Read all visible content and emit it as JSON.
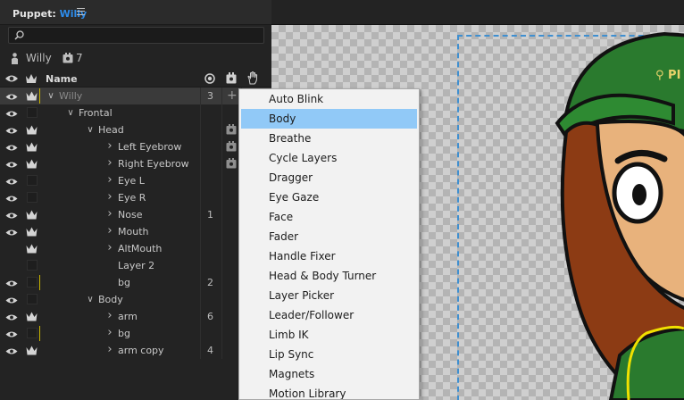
{
  "panel": {
    "title_prefix": "Puppet:",
    "title_name": "Willy",
    "puppet_name": "Willy",
    "handle_count": "7",
    "column_name": "Name"
  },
  "tree": [
    {
      "label": "Willy",
      "indent": 0,
      "arrow": "down",
      "eye": true,
      "crown": true,
      "yellow": true,
      "count": "3",
      "plus": true,
      "selected": true,
      "dim": true
    },
    {
      "label": "Frontal",
      "indent": 1,
      "arrow": "down",
      "eye": true,
      "crown": false,
      "yellow": false,
      "count": "",
      "dim": false
    },
    {
      "label": "Head",
      "indent": 2,
      "arrow": "down",
      "eye": true,
      "crown": true,
      "yellow": false,
      "count": "",
      "handle": true,
      "dim": false
    },
    {
      "label": "Left Eyebrow",
      "indent": 3,
      "arrow": "right",
      "eye": true,
      "crown": true,
      "yellow": false,
      "count": "",
      "handle": true,
      "dim": false
    },
    {
      "label": "Right Eyebrow",
      "indent": 3,
      "arrow": "right",
      "eye": true,
      "crown": true,
      "yellow": false,
      "count": "",
      "handle": true,
      "dim": false
    },
    {
      "label": "Eye L",
      "indent": 3,
      "arrow": "right",
      "eye": true,
      "crown": false,
      "yellow": false,
      "count": "",
      "dim": false
    },
    {
      "label": "Eye R",
      "indent": 3,
      "arrow": "right",
      "eye": true,
      "crown": false,
      "yellow": false,
      "count": "",
      "dim": false
    },
    {
      "label": "Nose",
      "indent": 3,
      "arrow": "right",
      "eye": true,
      "crown": true,
      "yellow": false,
      "count": "1",
      "dim": false
    },
    {
      "label": "Mouth",
      "indent": 3,
      "arrow": "right",
      "eye": true,
      "crown": true,
      "yellow": false,
      "count": "",
      "dim": false
    },
    {
      "label": "AltMouth",
      "indent": 3,
      "arrow": "right",
      "eye": false,
      "crown": true,
      "yellow": false,
      "count": "",
      "dim": false
    },
    {
      "label": "Layer 2",
      "indent": 3,
      "arrow": "none",
      "eye": false,
      "crown": false,
      "yellow": false,
      "count": "",
      "dim": false
    },
    {
      "label": "bg",
      "indent": 3,
      "arrow": "none",
      "eye": true,
      "crown": false,
      "yellow": true,
      "count": "2",
      "dim": false
    },
    {
      "label": "Body",
      "indent": 2,
      "arrow": "down",
      "eye": true,
      "crown": false,
      "yellow": false,
      "count": "",
      "dim": false
    },
    {
      "label": "arm",
      "indent": 3,
      "arrow": "right",
      "eye": true,
      "crown": true,
      "yellow": false,
      "count": "6",
      "dim": false
    },
    {
      "label": "bg",
      "indent": 3,
      "arrow": "right",
      "eye": true,
      "crown": false,
      "yellow": true,
      "count": "",
      "dim": false
    },
    {
      "label": "arm copy",
      "indent": 3,
      "arrow": "right",
      "eye": true,
      "crown": true,
      "yellow": false,
      "count": "4",
      "dim": false
    }
  ],
  "menu": {
    "items": [
      "Auto Blink",
      "Body",
      "Breathe",
      "Cycle Layers",
      "Dragger",
      "Eye Gaze",
      "Face",
      "Fader",
      "Handle Fixer",
      "Head & Body Turner",
      "Layer Picker",
      "Leader/Follower",
      "Limb IK",
      "Lip Sync",
      "Magnets",
      "Motion Library"
    ],
    "highlighted_index": 1
  },
  "colors": {
    "accent": "#2d8ceb",
    "menu_highlight": "#91c9f7",
    "panel_bg": "#232323"
  }
}
